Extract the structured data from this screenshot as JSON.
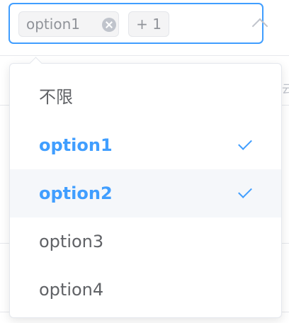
{
  "select": {
    "tags": [
      {
        "label": "option1"
      },
      {
        "label": "+ 1"
      }
    ]
  },
  "dropdown": {
    "options": [
      {
        "label": "不限",
        "selected": false
      },
      {
        "label": "option1",
        "selected": true
      },
      {
        "label": "option2",
        "selected": true
      },
      {
        "label": "option3",
        "selected": false
      },
      {
        "label": "option4",
        "selected": false
      }
    ]
  },
  "background": {
    "edge_glyph": "云"
  },
  "colors": {
    "accent": "#409eff",
    "text": "#606266",
    "tag_text": "#909399",
    "hover_bg": "#f5f7fa"
  }
}
